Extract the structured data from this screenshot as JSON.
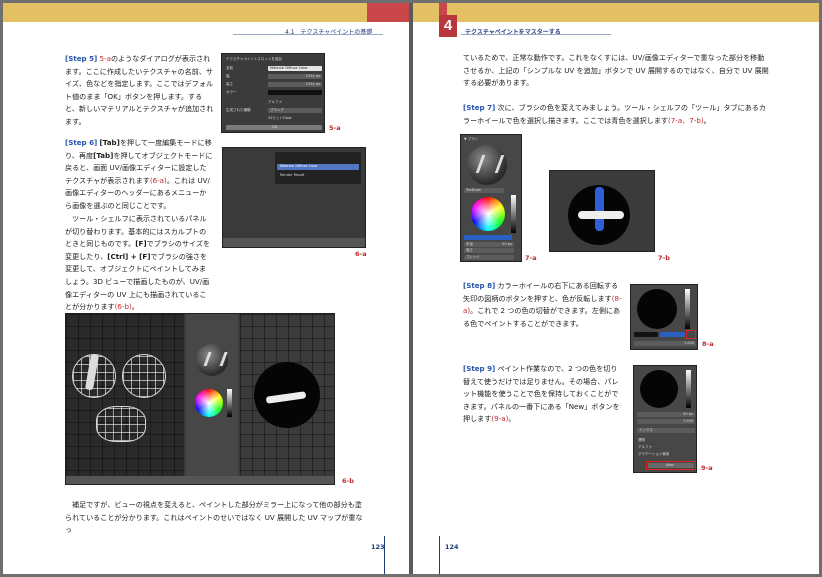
{
  "left_page": {
    "header": "4.1　テクスチャペイントの基礎",
    "step5": {
      "tag": "[Step 5]",
      "ref": "5-a",
      "text": "のようなダイアログが表示されます。ここに作成したいテクスチャの名前、サイズ、色などを指定します。ここではデフォルト値のまま「OK」ボタンを押します。すると、新しいマテリアルとテクスチャが追加されます。"
    },
    "step6": {
      "tag": "[Step 6]",
      "text_a": "を押して一度編集モードに移り、再度",
      "key_tab": "[Tab]",
      "text_b": "を押してオブジェクトモードに戻ると、画面 UV/画像エディターに設定したテクスチャが表示されます",
      "ref1": "(6-a)",
      "text_c": "。これは UV/画像エディターのヘッダーにあるメニューから画像を選ぶのと同じことです。",
      "text_d": "ツール・シェルフに表示されているパネルが切り替わります。基本的にはスカルプトのときと同じものです。",
      "key_f": "[F]",
      "text_e": "でブラシのサイズを変更したり、",
      "key_ctrl": "[Ctrl] + [F]",
      "text_f": "でブラシの強さを変更して、オブジェクトにペイントしてみましょう。3D ビューで描画したものが、UV/画像エディターの UV 上にも描画されていることが分かります",
      "ref2": "(6-b)",
      "text_g": "。"
    },
    "bottom_text": "補足ですが、ビューの視点を変えると、ペイントした部分がミラー上になって他の部分も塗られていることが分かります。これはペイントのせいではなく UV 展開した UV マップが重なっ",
    "page_number": "123",
    "captions": {
      "c5a": "5-a",
      "c6a": "6-a",
      "c6b": "6-b"
    },
    "dialog": {
      "title": "テクスチャペイントスロットを追加",
      "name_label": "名前",
      "name_value": "Material Diffuse Color",
      "width_label": "幅",
      "width_value": "1024 px",
      "height_label": "高さ",
      "height_value": "1024 px",
      "color_label": "カラー",
      "alpha_label": "アルファ",
      "type_label": "生成された種類",
      "type_value": "ブランク",
      "float_label": "32ビットFloat",
      "ok_label": "OK"
    },
    "menu": {
      "item1": "Material Diffuse Color",
      "item2": "Render Result"
    }
  },
  "right_page": {
    "chapter_number": "4",
    "header": "テクスチャペイントをマスターする",
    "intro_text": "ているためで、正常な動作です。これをなくすには、UV/画像エディターで重なった部分を移動させるか、上記の「シンプルな UV を追加」ボタンで UV 展開するのではなく、自分で UV 展開する必要があります。",
    "step7": {
      "tag": "[Step 7]",
      "text": "次に、ブラシの色を変えてみましょう。ツール・シェルフの「ツール」タブにあるカラーホイールで色を選択し描きます。ここでは青色を選択します",
      "ref": "(7-a、7-b)",
      "end": "。"
    },
    "step8": {
      "tag": "[Step 8]",
      "text": "カラーホイールの右下にある回転する矢印の図柄のボタンを押すと、色が反転します",
      "ref": "(8-a)",
      "text2": "。これで 2 つの色の切替ができます。左側にある色でペイントすることができます。"
    },
    "step9": {
      "tag": "[Step 9]",
      "text": "ペイント作業なので、2 つの色を切り替えて使うだけでは足りません。その場合、パレット機能を使うことで色を保持しておくことができます。パネルの一番下にある「New」ボタンを押します",
      "ref": "(9-a)",
      "end": "。"
    },
    "captions": {
      "c7a": "7-a",
      "c7b": "7-b",
      "c8a": "8-a",
      "c9a": "9-a"
    },
    "panel": {
      "brush_label": "▼ ブラシ",
      "texdraw": "TexDraw",
      "radius_label": "半径",
      "radius_value": "50 px",
      "strength_label": "強さ",
      "strength_value": "1.000",
      "blend_label": "ブレンド",
      "blend_value": "ミックス",
      "new_label": "New",
      "palette_items": [
        "透明",
        "アルファ",
        "グラデーション使用"
      ]
    },
    "page_number": "124"
  },
  "colors": {
    "header_gold": "#e3c063",
    "accent_red": "#c9464a",
    "step_blue": "#2353a8",
    "ref_red": "#c0282d"
  }
}
